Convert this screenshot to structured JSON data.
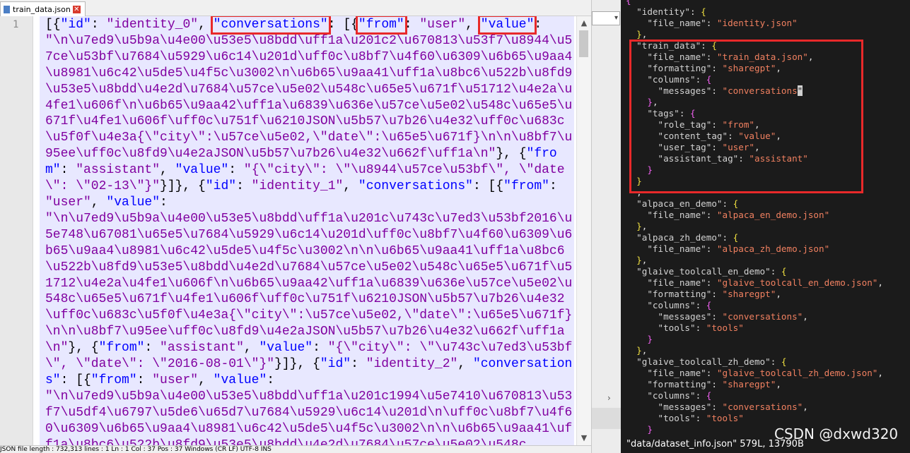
{
  "tab": {
    "filename": "train_data.json",
    "close": "✕"
  },
  "editor": {
    "line_number": "1",
    "segments": [
      [
        "p",
        "[{"
      ],
      [
        "k",
        "\"id\""
      ],
      [
        "p",
        ": "
      ],
      [
        "s",
        "\"identity_0\""
      ],
      [
        "p",
        ", "
      ],
      [
        "khl",
        "\"conversations\""
      ],
      [
        "p",
        ": "
      ],
      [
        "p",
        "[{"
      ],
      [
        "khl",
        "\"from\""
      ],
      [
        "p",
        ": "
      ],
      [
        "s",
        "\"user\""
      ],
      [
        "p",
        ", "
      ],
      [
        "khl",
        "\"value\""
      ],
      [
        "p",
        ":\n"
      ],
      [
        "s",
        "\"\\n\\u7ed9\\u5b9a\\u4e00\\u53e5\\u8bdd\\uff1a\\u201c2\\u670813\\u53f7\\u8944\\u57ce\\u53bf\\u7684\\u5929\\u6c14\\u201d\\uff0c\\u8bf7\\u4f60\\u6309\\u6b65\\u9aa4\\u8981\\u6c42\\u5de5\\u4f5c\\u3002\\n\\u6b65\\u9aa41\\uff1a\\u8bc6\\u522b\\u8fd9\\u53e5\\u8bdd\\u4e2d\\u7684\\u57ce\\u5e02\\u548c\\u65e5\\u671f\\u51712\\u4e2a\\u4fe1\\u606f\\n\\u6b65\\u9aa42\\uff1a\\u6839\\u636e\\u57ce\\u5e02\\u548c\\u65e5\\u671f\\u4fe1\\u606f\\uff0c\\u751f\\u6210JSON\\u5b57\\u7b26\\u4e32\\uff0c\\u683c\\u5f0f\\u4e3a{\\\"city\\\":\\u57ce\\u5e02,\\\"date\\\":\\u65e5\\u671f}\\n\\n\\u8bf7\\u95ee\\uff0c\\u8fd9\\u4e2aJSON\\u5b57\\u7b26\\u4e32\\u662f\\uff1a\\n\""
      ],
      [
        "p",
        "}, {"
      ],
      [
        "k",
        "\"from\""
      ],
      [
        "p",
        ": "
      ],
      [
        "s",
        "\"assistant\""
      ],
      [
        "p",
        ", "
      ],
      [
        "k",
        "\"value\""
      ],
      [
        "p",
        ": "
      ],
      [
        "s",
        "\"{\\\"city\\\": \\\"\\u8944\\u57ce\\u53bf\\\", \\\"date\\\": \\\"02-13\\\"}\""
      ],
      [
        "p",
        "}]}, {"
      ],
      [
        "k",
        "\"id\""
      ],
      [
        "p",
        ": "
      ],
      [
        "s",
        "\"identity_1\""
      ],
      [
        "p",
        ", "
      ],
      [
        "k",
        "\"conversations\""
      ],
      [
        "p",
        ": [{"
      ],
      [
        "k",
        "\"from\""
      ],
      [
        "p",
        ": "
      ],
      [
        "s",
        "\"user\""
      ],
      [
        "p",
        ", "
      ],
      [
        "k",
        "\"value\""
      ],
      [
        "p",
        ":\n"
      ],
      [
        "s",
        "\"\\n\\u7ed9\\u5b9a\\u4e00\\u53e5\\u8bdd\\uff1a\\u201c\\u743c\\u7ed3\\u53bf2016\\u5e748\\u67081\\u65e5\\u7684\\u5929\\u6c14\\u201d\\uff0c\\u8bf7\\u4f60\\u6309\\u6b65\\u9aa4\\u8981\\u6c42\\u5de5\\u4f5c\\u3002\\n\\n\\u6b65\\u9aa41\\uff1a\\u8bc6\\u522b\\u8fd9\\u53e5\\u8bdd\\u4e2d\\u7684\\u57ce\\u5e02\\u548c\\u65e5\\u671f\\u51712\\u4e2a\\u4fe1\\u606f\\n\\u6b65\\u9aa42\\uff1a\\u6839\\u636e\\u57ce\\u5e02\\u548c\\u65e5\\u671f\\u4fe1\\u606f\\uff0c\\u751f\\u6210JSON\\u5b57\\u7b26\\u4e32\\uff0c\\u683c\\u5f0f\\u4e3a{\\\"city\\\":\\u57ce\\u5e02,\\\"date\\\":\\u65e5\\u671f}\\n\\n\\u8bf7\\u95ee\\uff0c\\u8fd9\\u4e2aJSON\\u5b57\\u7b26\\u4e32\\u662f\\uff1a\\n\""
      ],
      [
        "p",
        "}, {"
      ],
      [
        "k",
        "\"from\""
      ],
      [
        "p",
        ": "
      ],
      [
        "s",
        "\"assistant\""
      ],
      [
        "p",
        ", "
      ],
      [
        "k",
        "\"value\""
      ],
      [
        "p",
        ": "
      ],
      [
        "s",
        "\"{\\\"city\\\": \\\"\\u743c\\u7ed3\\u53bf\\\", \\\"date\\\": \\\"2016-08-01\\\"}\""
      ],
      [
        "p",
        "}]}, {"
      ],
      [
        "k",
        "\"id\""
      ],
      [
        "p",
        ": "
      ],
      [
        "s",
        "\"identity_2\""
      ],
      [
        "p",
        ", "
      ],
      [
        "k",
        "\"conversations\""
      ],
      [
        "p",
        ": [{"
      ],
      [
        "k",
        "\"from\""
      ],
      [
        "p",
        ": "
      ],
      [
        "s",
        "\"user\""
      ],
      [
        "p",
        ", "
      ],
      [
        "k",
        "\"value\""
      ],
      [
        "p",
        ":\n"
      ],
      [
        "s",
        "\"\\n\\u7ed9\\u5b9a\\u4e00\\u53e5\\u8bdd\\uff1a\\u201c1994\\u5e7410\\u670813\\u53f7\\u5df4\\u6797\\u5de6\\u65d7\\u7684\\u5929\\u6c14\\u201d\\n\\uff0c\\u8bf7\\u4f60\\u6309\\u6b65\\u9aa4\\u8981\\u6c42\\u5de5\\u4f5c\\u3002\\n\\n\\u6b65\\u9aa41\\uff1a\\u8bc6\\u522b\\u8fd9\\u53e5\\u8bdd\\u4e2d\\u7684\\u57ce\\u5e02\\u548c"
      ]
    ]
  },
  "status_bar": "JSON file    length : 732,313    lines : 1    Ln : 1    Col : 37    Pos : 37    Windows (CR LF)    UTF-8    INS",
  "right_editor": {
    "status": "\"data/dataset_info.json\" 579L, 13790B",
    "watermark": "CSDN @dxwd320"
  }
}
